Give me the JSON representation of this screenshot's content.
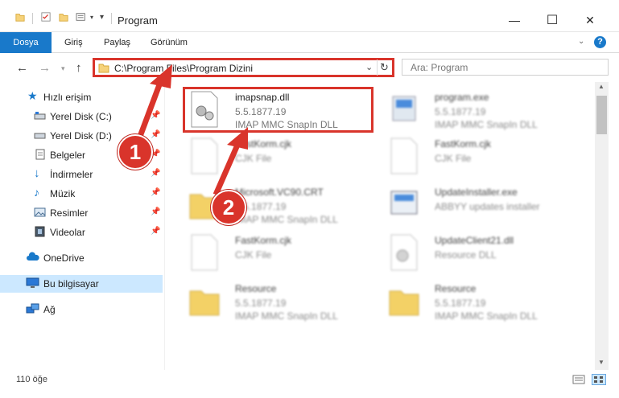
{
  "window": {
    "title": "Program",
    "controls": {
      "minimize": "—",
      "maximize": "☐",
      "close": "✕"
    }
  },
  "ribbon": {
    "tabs": [
      "Dosya",
      "Giriş",
      "Paylaş",
      "Görünüm"
    ],
    "help": "?"
  },
  "address": {
    "path": "C:\\Program Files\\Program Dizini",
    "search_placeholder": "Ara: Program"
  },
  "sidebar": {
    "items": [
      {
        "label": "Hızlı erişim",
        "icon": "star-icon"
      },
      {
        "label": "Yerel Disk (C:)",
        "icon": "drive-icon"
      },
      {
        "label": "Yerel Disk (D:)",
        "icon": "drive-icon"
      },
      {
        "label": "Belgeler",
        "icon": "document-icon"
      },
      {
        "label": "İndirmeler",
        "icon": "download-arrow-icon"
      },
      {
        "label": "Müzik",
        "icon": "music-note-icon"
      },
      {
        "label": "Resimler",
        "icon": "picture-icon"
      },
      {
        "label": "Videolar",
        "icon": "film-icon"
      },
      {
        "label": "OneDrive",
        "icon": "cloud-icon"
      },
      {
        "label": "Bu bilgisayar",
        "icon": "computer-icon"
      },
      {
        "label": "Ağ",
        "icon": "network-icon"
      }
    ]
  },
  "files": [
    {
      "name": "imapsnap.dll",
      "line2": "5.5.1877.19",
      "line3": "IMAP MMC SnapIn DLL",
      "icon": "gear-file-icon"
    },
    {
      "name": "program.exe",
      "line2": "5.5.1877.19",
      "line3": "IMAP MMC SnapIn DLL",
      "icon": "exe-icon"
    },
    {
      "name": "FastKorm.cjk",
      "line2": "CJK File",
      "line3": "",
      "icon": "blank-file-icon"
    },
    {
      "name": "FastKorm.cjk",
      "line2": "CJK File",
      "line3": "",
      "icon": "blank-file-icon"
    },
    {
      "name": "Microsoft.VC90.CRT",
      "line2": "5.5.1877.19",
      "line3": "IMAP MMC SnapIn DLL",
      "icon": "folder-icon"
    },
    {
      "name": "UpdateInstaller.exe",
      "line2": "ABBYY updates installer",
      "line3": "",
      "icon": "installer-icon"
    },
    {
      "name": "FastKorm.cjk",
      "line2": "CJK File",
      "line3": "",
      "icon": "blank-file-icon"
    },
    {
      "name": "UpdateClient21.dll",
      "line2": "Resource DLL",
      "line3": "",
      "icon": "gear-file-icon"
    },
    {
      "name": "Resource",
      "line2": "5.5.1877.19",
      "line3": "IMAP MMC SnapIn DLL",
      "icon": "folder-icon"
    },
    {
      "name": "Resource",
      "line2": "5.5.1877.19",
      "line3": "IMAP MMC SnapIn DLL",
      "icon": "folder-icon"
    }
  ],
  "callouts": {
    "one": "1",
    "two": "2"
  },
  "status": {
    "count": "110 öğe"
  },
  "colors": {
    "accent": "#1979ca",
    "highlight": "#d9342b",
    "selected": "#cce8ff"
  }
}
